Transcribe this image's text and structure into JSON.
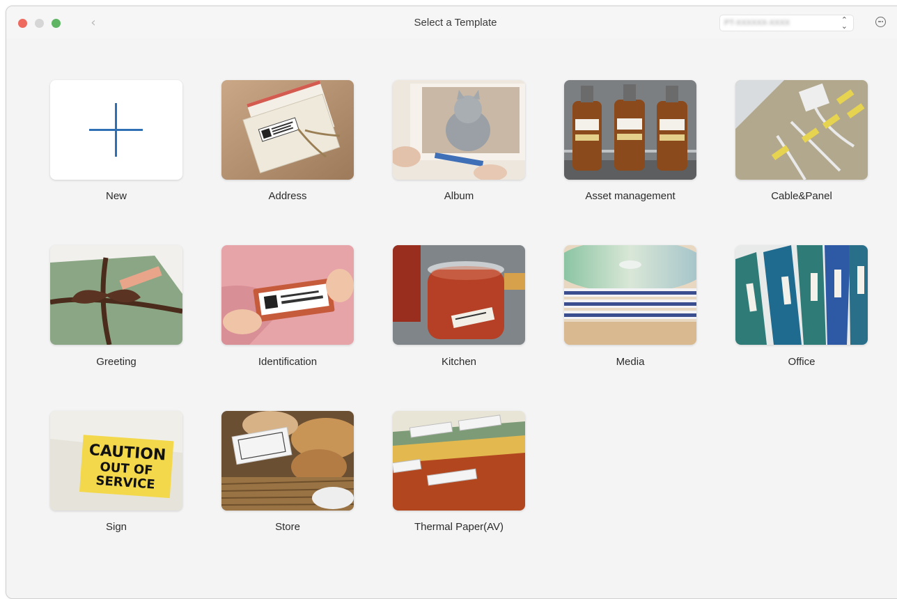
{
  "window": {
    "title": "Select a Template",
    "printer_value": "PT-XXXXXX-XXXX"
  },
  "templates": [
    {
      "label": "New"
    },
    {
      "label": "Address"
    },
    {
      "label": "Album"
    },
    {
      "label": "Asset management"
    },
    {
      "label": "Cable&Panel"
    },
    {
      "label": "Greeting"
    },
    {
      "label": "Identification"
    },
    {
      "label": "Kitchen"
    },
    {
      "label": "Media"
    },
    {
      "label": "Office"
    },
    {
      "label": "Sign"
    },
    {
      "label": "Store"
    },
    {
      "label": "Thermal Paper(AV)"
    }
  ],
  "sign_text": [
    "CAUTION",
    "OUT OF",
    "SERVICE"
  ],
  "colors": {
    "accent_blue": "#2f6fb4",
    "close": "#ee6a5e",
    "zoom": "#5fb564"
  }
}
